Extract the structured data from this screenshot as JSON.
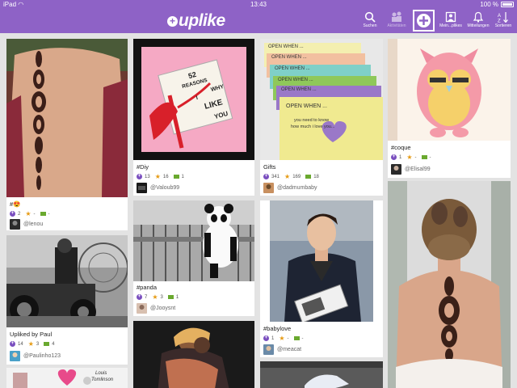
{
  "status_bar": {
    "device": "iPad",
    "time": "13:43",
    "battery": "100 %"
  },
  "app": {
    "logo_text": "uplike"
  },
  "nav": {
    "search": "Suchen",
    "activity": "Aktivitäten",
    "profile": "Mein...plikes",
    "notifications": "Mitteilungen",
    "sort": "Sortieren"
  },
  "posts": [
    {
      "caption": "#😍",
      "uplikes": "2",
      "stars": "-",
      "comments": "-",
      "user": "@lenou"
    },
    {
      "caption": "Upliked by Paul",
      "uplikes": "14",
      "stars": "3",
      "comments": "4",
      "user": "@Paulinho123"
    },
    {
      "caption": "#Diy",
      "uplikes": "13",
      "stars": "16",
      "comments": "1",
      "user": "@Valoub99"
    },
    {
      "caption": "#panda",
      "uplikes": "7",
      "stars": "3",
      "comments": "1",
      "user": "@Jooysnt"
    },
    {
      "caption": "Gifts",
      "uplikes": "341",
      "stars": "169",
      "comments": "18",
      "user": "@dadmumbaby"
    },
    {
      "caption": "#babylove",
      "uplikes": "1",
      "stars": "-",
      "comments": "-",
      "user": "@meacat"
    },
    {
      "caption": "#coque",
      "uplikes": "1",
      "stars": "-",
      "comments": "-",
      "user": "@Elisal99"
    }
  ],
  "images": {
    "diy_text": [
      "52",
      "REASONS",
      "WHY",
      "I",
      "LIKE",
      "YOU"
    ],
    "gifts_text": [
      "OPEN WHEN ...",
      "OPEN WHEN ...",
      "OPEN WHEN ...",
      "OPEN WHEN ...",
      "OPEN WHEN ...",
      "OPEN WHEN ...",
      "you need to know",
      "how much i love you..."
    ],
    "bottom_text": [
      "Louis",
      "Tomlinson"
    ]
  },
  "colors": {
    "brand": "#8e62c6",
    "uplike": "#7a4fbf",
    "star": "#e69b14",
    "comment": "#6aa92f"
  }
}
